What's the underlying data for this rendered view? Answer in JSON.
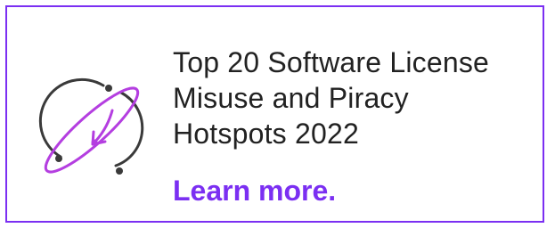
{
  "promo": {
    "title_lines": [
      "Top 20 Software License",
      "Misuse and Piracy",
      "Hotspots 2022"
    ],
    "cta_label": "Learn more."
  },
  "colors": {
    "accent": "#7b2ff2",
    "text": "#222222",
    "icon_dark": "#3a3a3a",
    "background": "#ffffff"
  },
  "icons": {
    "logo": "orbit-arrow-icon"
  }
}
